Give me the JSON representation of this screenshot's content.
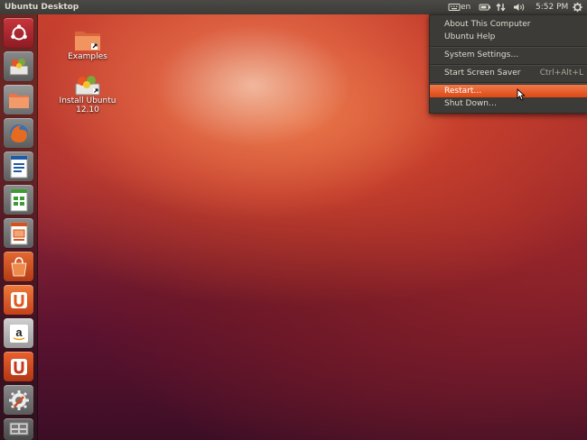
{
  "topbar": {
    "title": "Ubuntu Desktop",
    "keyboard_layout": "en",
    "time": "5:52 PM"
  },
  "desktop_icons": [
    {
      "label": "Examples",
      "icon": "folder-icon"
    },
    {
      "label": "Install Ubuntu 12.10",
      "icon": "install-icon"
    }
  ],
  "launcher_items": [
    {
      "name": "dash-home",
      "icon": "ubuntu-logo-icon"
    },
    {
      "name": "install-ubuntu",
      "icon": "install-icon"
    },
    {
      "name": "files",
      "icon": "folder-icon"
    },
    {
      "name": "firefox",
      "icon": "firefox-icon"
    },
    {
      "name": "libreoffice-writer",
      "icon": "writer-icon"
    },
    {
      "name": "libreoffice-calc",
      "icon": "calc-icon"
    },
    {
      "name": "libreoffice-impress",
      "icon": "impress-icon"
    },
    {
      "name": "software-center",
      "icon": "software-center-icon"
    },
    {
      "name": "ubuntu-one",
      "icon": "ubuntu-one-icon"
    },
    {
      "name": "amazon",
      "icon": "amazon-icon"
    },
    {
      "name": "ubuntu-one-music",
      "icon": "ubuntu-one-music-icon"
    },
    {
      "name": "system-settings",
      "icon": "settings-icon"
    },
    {
      "name": "workspace-switcher",
      "icon": "workspace-icon"
    }
  ],
  "session_menu": {
    "items": [
      {
        "label": "About This Computer",
        "accel": ""
      },
      {
        "label": "Ubuntu Help",
        "accel": ""
      },
      {
        "label": "System Settings…",
        "accel": ""
      },
      {
        "label": "Start Screen Saver",
        "accel": "Ctrl+Alt+L"
      },
      {
        "label": "Restart…",
        "accel": "",
        "highlighted": true
      },
      {
        "label": "Shut Down…",
        "accel": ""
      }
    ]
  },
  "colors": {
    "panel": "#3c3b37",
    "accent": "#dd4814",
    "panel_text": "#dfdbd2"
  }
}
